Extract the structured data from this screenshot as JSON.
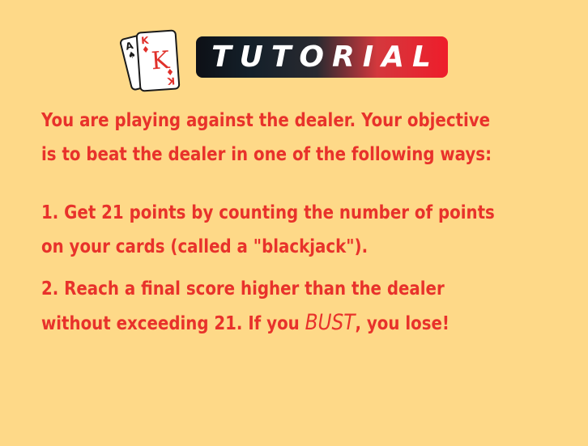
{
  "header": {
    "title": "TUTORIAL",
    "cards": {
      "back": {
        "rank": "A",
        "suit": "♠"
      },
      "front": {
        "rank": "K",
        "suit": "♦",
        "center": "K"
      }
    }
  },
  "content": {
    "intro_line1": "You are playing against the dealer. Your objective",
    "intro_line2": "is to beat the dealer in one of the following ways:",
    "rule1_line1": "1. Get 21 points by counting the number of points",
    "rule1_line2": "on your cards (called a \"blackjack\").",
    "rule2_line1": "2. Reach a final score higher than the dealer",
    "rule2_line2_before": "without exceeding 21. If you ",
    "rule2_bust": "BUST",
    "rule2_line2_after": ", you lose!"
  },
  "colors": {
    "background": "#fed988",
    "text": "#e8322b",
    "banner_left": "#0d1016",
    "banner_right": "#ee1d2b"
  }
}
